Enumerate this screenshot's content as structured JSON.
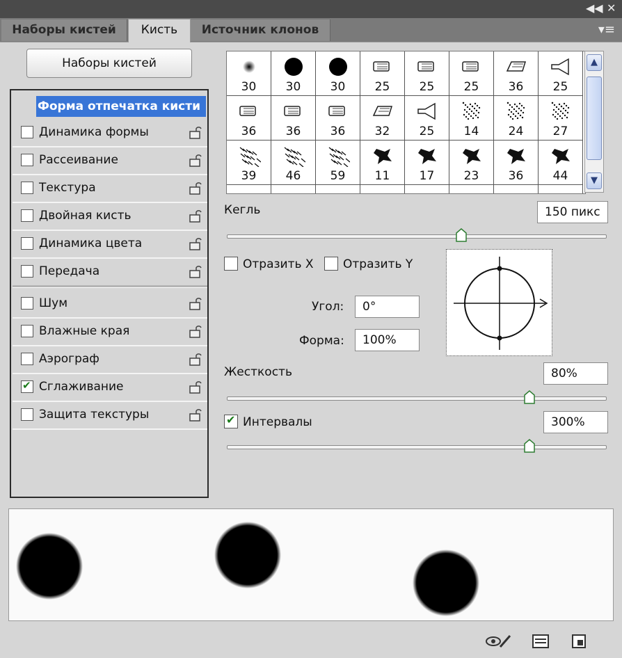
{
  "tabs": [
    {
      "label": "Наборы кистей"
    },
    {
      "label": "Кисть"
    },
    {
      "label": "Источник клонов"
    }
  ],
  "window_controls": {
    "collapse": "◀◀",
    "close": "✕",
    "panel_menu": "▾≡"
  },
  "presets_button": "Наборы кистей",
  "left_panel": {
    "selected": "Форма отпечатка кисти",
    "options": [
      {
        "label": "Динамика формы",
        "checked": false
      },
      {
        "label": "Рассеивание",
        "checked": false
      },
      {
        "label": "Текстура",
        "checked": false
      },
      {
        "label": "Двойная кисть",
        "checked": false
      },
      {
        "label": "Динамика цвета",
        "checked": false
      },
      {
        "label": "Передача",
        "checked": false
      },
      {
        "label": "Шум",
        "checked": false
      },
      {
        "label": "Влажные края",
        "checked": false
      },
      {
        "label": "Аэрограф",
        "checked": false
      },
      {
        "label": "Сглаживание",
        "checked": true
      },
      {
        "label": "Защита текстуры",
        "checked": false
      }
    ]
  },
  "brush_grid": {
    "rows": [
      [
        "30",
        "30",
        "30",
        "25",
        "25",
        "25",
        "36",
        "25"
      ],
      [
        "36",
        "36",
        "36",
        "32",
        "25",
        "14",
        "24",
        "27"
      ],
      [
        "39",
        "46",
        "59",
        "11",
        "17",
        "23",
        "36",
        "44"
      ]
    ],
    "icons": [
      [
        "soft-round-brush-icon",
        "hard-round-brush-icon",
        "hard-round-brush-icon",
        "flat-tip-brush-icon",
        "flat-tip-brush-icon",
        "flat-tip-brush-icon",
        "angled-brush-icon",
        "fan-brush-icon"
      ],
      [
        "flat-tip-brush-icon",
        "flat-tip-brush-icon",
        "flat-tip-brush-icon",
        "angled-brush-icon",
        "fan-brush-icon",
        "scatter-brush-icon",
        "scatter-brush-icon",
        "scatter-brush-icon"
      ],
      [
        "texture-brush-icon",
        "texture-brush-icon",
        "texture-brush-icon",
        "splatter-brush-icon",
        "splatter-brush-icon",
        "splatter-brush-icon",
        "splatter-brush-icon",
        "splatter-brush-icon"
      ]
    ]
  },
  "size": {
    "label": "Кегль",
    "value": "150 пикс",
    "slider_fraction": 0.62
  },
  "flip_x": {
    "label": "Отразить X",
    "checked": false
  },
  "flip_y": {
    "label": "Отразить Y",
    "checked": false
  },
  "angle": {
    "label": "Угол:",
    "value": "0°"
  },
  "roundness": {
    "label": "Форма:",
    "value": "100%"
  },
  "hardness": {
    "label": "Жесткость",
    "value": "80%",
    "slider_fraction": 0.8
  },
  "spacing": {
    "label": "Интервалы",
    "checked": true,
    "value": "300%",
    "slider_fraction": 0.8
  },
  "bottom_icons": [
    "eye-brush-icon",
    "panel-menu-icon",
    "new-preset-icon"
  ]
}
